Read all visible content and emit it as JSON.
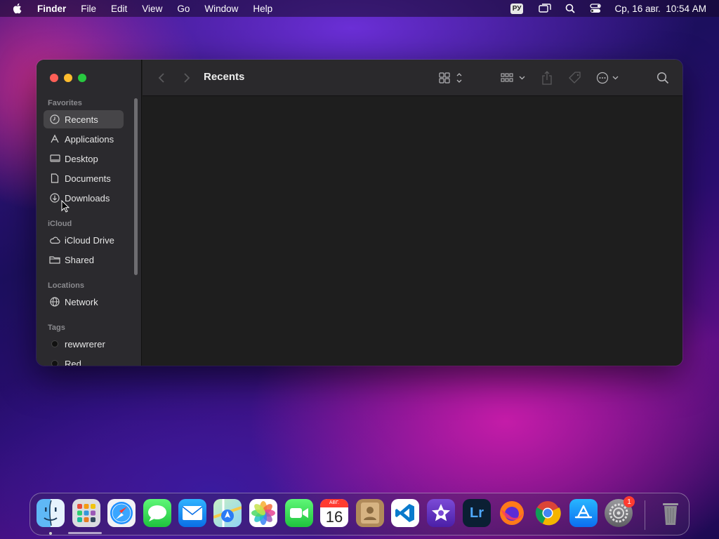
{
  "menubar": {
    "app_name": "Finder",
    "items": [
      "File",
      "Edit",
      "View",
      "Go",
      "Window",
      "Help"
    ],
    "language": "РУ",
    "datetime": "Ср, 16 авг.  10:54 AM",
    "icons": [
      "apple-icon",
      "screen-mirror-icon",
      "spotlight-icon",
      "control-center-icon"
    ]
  },
  "window": {
    "title": "Recents",
    "toolbar_icons": [
      "back-icon",
      "forward-icon",
      "icon-view-icon",
      "group-icon",
      "share-icon",
      "tag-icon",
      "more-actions-icon",
      "search-icon"
    ]
  },
  "sidebar": {
    "favorites_title": "Favorites",
    "favorites": [
      {
        "label": "Recents",
        "icon": "clock-icon",
        "selected": true
      },
      {
        "label": "Applications",
        "icon": "applications-icon"
      },
      {
        "label": "Desktop",
        "icon": "desktop-icon"
      },
      {
        "label": "Documents",
        "icon": "document-icon"
      },
      {
        "label": "Downloads",
        "icon": "download-icon"
      }
    ],
    "icloud_title": "iCloud",
    "icloud": [
      {
        "label": "iCloud Drive",
        "icon": "cloud-icon"
      },
      {
        "label": "Shared",
        "icon": "shared-folder-icon"
      }
    ],
    "locations_title": "Locations",
    "locations": [
      {
        "label": "Network",
        "icon": "globe-icon"
      }
    ],
    "tags_title": "Tags",
    "tags": [
      {
        "label": "rewwrerer",
        "color": "#111111"
      },
      {
        "label": "Red",
        "color": "#111111"
      }
    ]
  },
  "dock": {
    "apps": [
      "Finder",
      "Launchpad",
      "Safari",
      "Messages",
      "Mail",
      "Maps",
      "Photos",
      "FaceTime",
      "Calendar",
      "Contacts",
      "Visual Studio Code",
      "iMovie",
      "Lightroom",
      "Firefox",
      "Chrome",
      "App Store",
      "System Settings",
      "Trash"
    ],
    "calendar_month": "АВГ.",
    "calendar_day": "16",
    "lightroom_label": "Lr",
    "settings_badge": "1"
  },
  "colors": {
    "close": "#fe5f57",
    "minimize": "#febc2e",
    "maximize": "#28c840",
    "sidebar_bg": "#2b2a2e",
    "window_bg": "#1e1e1e"
  }
}
